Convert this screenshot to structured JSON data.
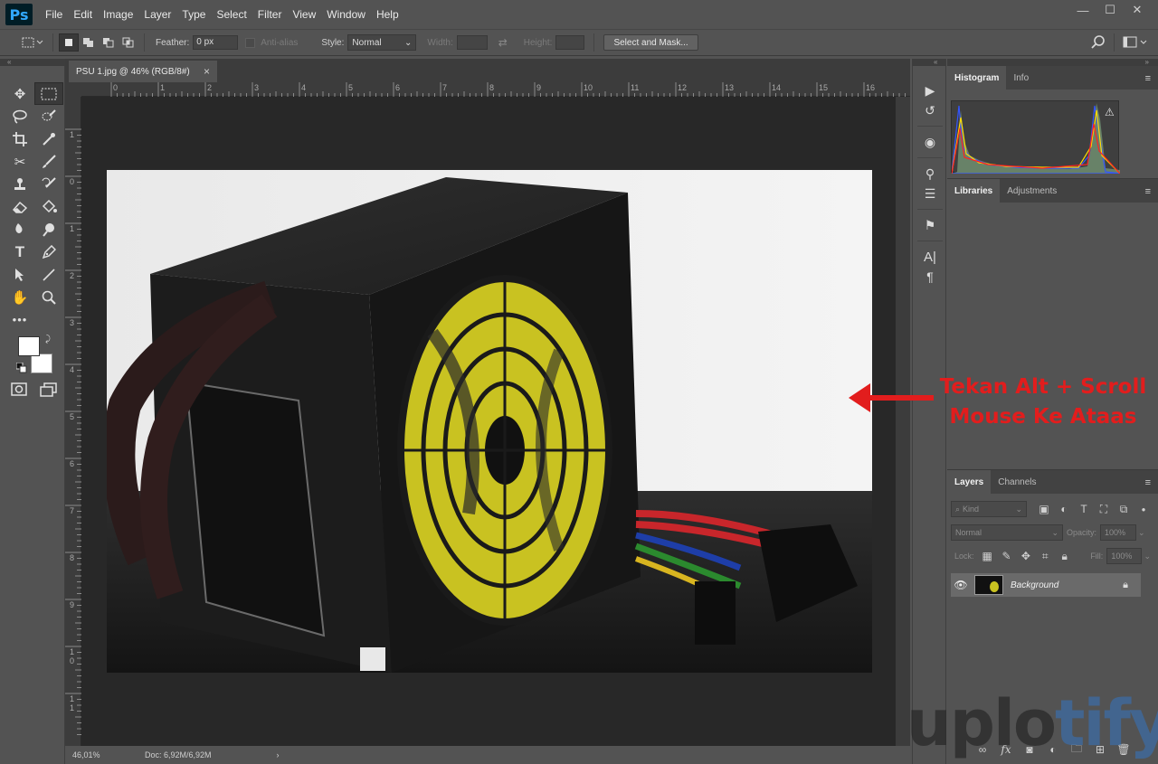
{
  "app": {
    "logo": "Ps"
  },
  "menu": [
    "File",
    "Edit",
    "Image",
    "Layer",
    "Type",
    "Select",
    "Filter",
    "View",
    "Window",
    "Help"
  ],
  "window_controls": {
    "minimize": "—",
    "maximize": "☐",
    "close": "✕"
  },
  "options_bar": {
    "feather_label": "Feather:",
    "feather_value": "0 px",
    "antialias_label": "Anti-alias",
    "style_label": "Style:",
    "style_value": "Normal",
    "width_label": "Width:",
    "height_label": "Height:",
    "select_mask_label": "Select and Mask..."
  },
  "document": {
    "tab_title": "PSU 1.jpg @ 46% (RGB/8#)",
    "tab_close": "×",
    "zoom": "46,01%",
    "doc_info": "Doc: 6,92M/6,92M"
  },
  "ruler": {
    "h_labels": [
      "0",
      "1",
      "2",
      "3",
      "4",
      "5",
      "6",
      "7",
      "8",
      "9",
      "10",
      "11",
      "12",
      "13",
      "14",
      "15",
      "16"
    ],
    "v_labels": [
      "1",
      "0",
      "1",
      "2",
      "3",
      "4",
      "5",
      "6",
      "7",
      "8",
      "9",
      "1 0",
      "1 1"
    ]
  },
  "panels": {
    "histogram": {
      "tabs": [
        "Histogram",
        "Info"
      ],
      "warning": "⚠"
    },
    "libraries": {
      "tabs": [
        "Libraries",
        "Adjustments"
      ]
    },
    "layers": {
      "tabs": [
        "Layers",
        "Channels"
      ],
      "kind_placeholder": "Kind",
      "blend_mode": "Normal",
      "opacity_label": "Opacity:",
      "opacity_value": "100%",
      "lock_label": "Lock:",
      "fill_label": "Fill:",
      "fill_value": "100%",
      "layer_name": "Background"
    }
  },
  "annotation": {
    "line1": "Tekan Alt + Scroll",
    "line2": "Mouse Ke Ataas",
    "color": "#e21d1d"
  },
  "watermark": {
    "part1": "uplo",
    "part2": "tify"
  }
}
